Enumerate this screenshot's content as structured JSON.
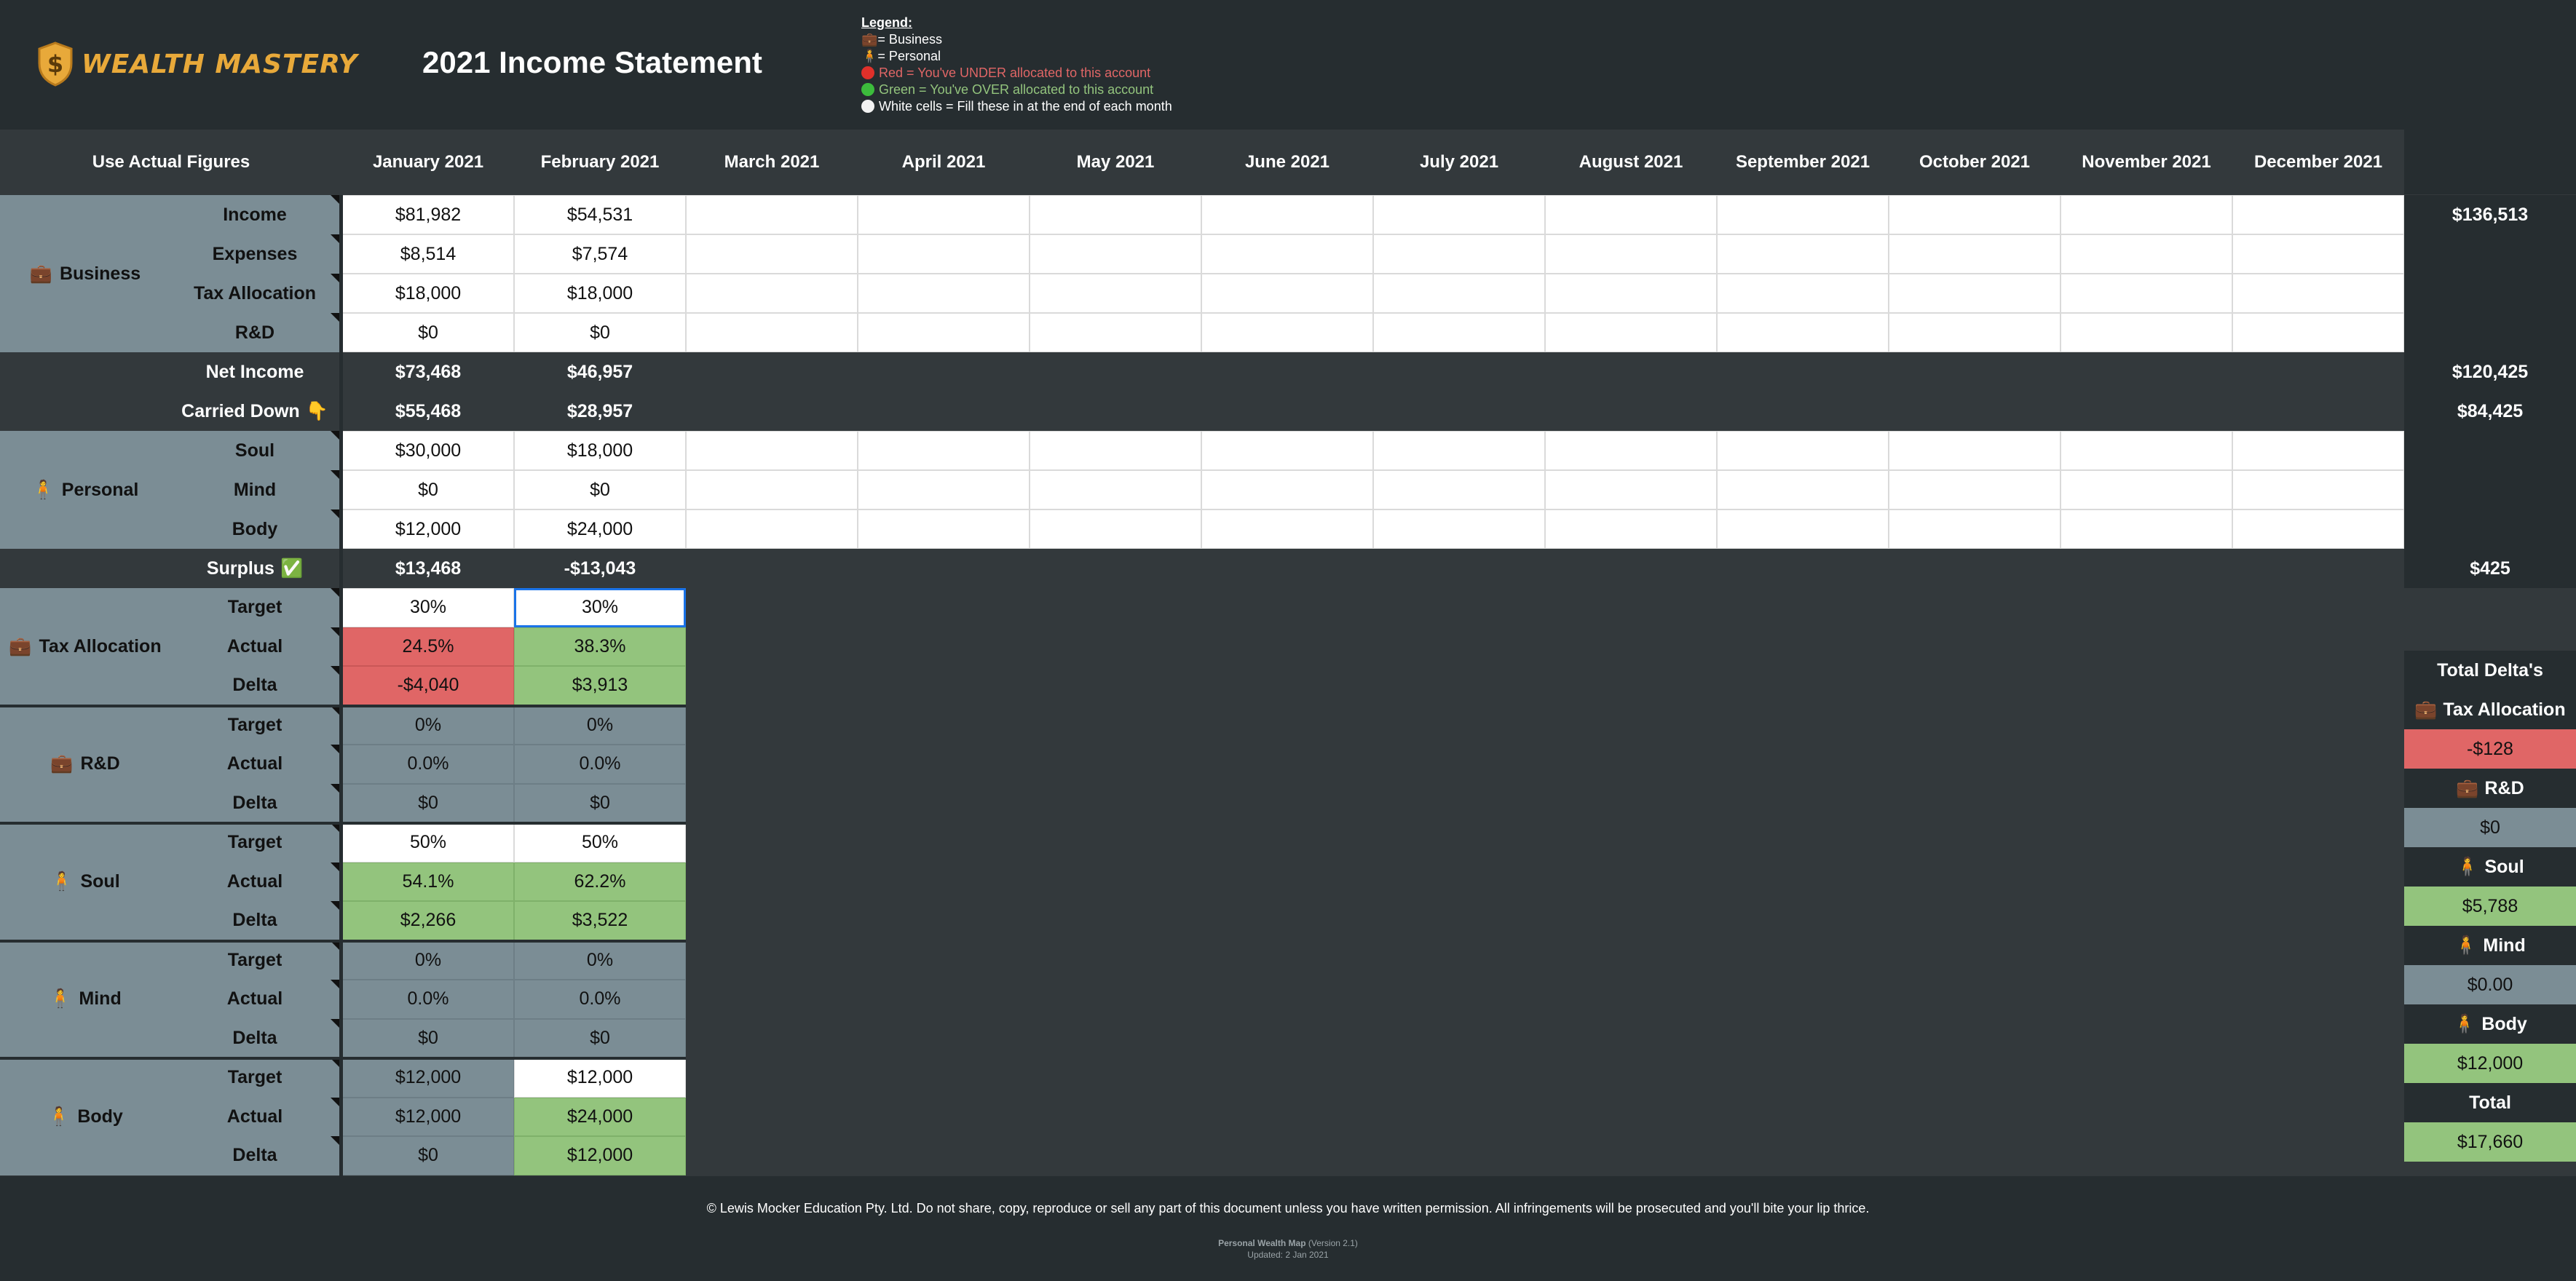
{
  "brand": {
    "name": "WEALTH MASTERY",
    "logo_icon": "shield-dollar-icon",
    "accent": "#e8a93a"
  },
  "title": "2021 Income Statement",
  "legend": {
    "heading": "Legend:",
    "business": "= Business",
    "personal": "= Personal",
    "red": "Red = You've UNDER allocated to this account",
    "green": "Green = You've OVER allocated to this account",
    "white": "White cells = Fill these in at the end of each month",
    "colors": {
      "red": "#e06666",
      "green": "#93c47d",
      "red_text": "#e06666",
      "green_text": "#93c47d"
    }
  },
  "header": {
    "corner": "Use Actual Figures",
    "months": [
      "January 2021",
      "February 2021",
      "March 2021",
      "April 2021",
      "May 2021",
      "June 2021",
      "July 2021",
      "August 2021",
      "September 2021",
      "October 2021",
      "November 2021",
      "December 2021"
    ]
  },
  "business": {
    "group": "Business",
    "rows": [
      {
        "label": "Income",
        "values": [
          "$81,982",
          "$54,531"
        ],
        "total": "$136,513"
      },
      {
        "label": "Expenses",
        "values": [
          "$8,514",
          "$7,574"
        ],
        "total": ""
      },
      {
        "label": "Tax Allocation",
        "values": [
          "$18,000",
          "$18,000"
        ],
        "total": ""
      },
      {
        "label": "R&D",
        "values": [
          "$0",
          "$0"
        ],
        "total": ""
      }
    ]
  },
  "net_income": {
    "label": "Net Income",
    "values": [
      "$73,468",
      "$46,957"
    ],
    "total": "$120,425"
  },
  "carried_down": {
    "label": "Carried Down",
    "icon": "👇",
    "values": [
      "$55,468",
      "$28,957"
    ],
    "total": "$84,425"
  },
  "personal": {
    "group": "Personal",
    "rows": [
      {
        "label": "Soul",
        "values": [
          "$30,000",
          "$18,000"
        ]
      },
      {
        "label": "Mind",
        "values": [
          "$0",
          "$0"
        ]
      },
      {
        "label": "Body",
        "values": [
          "$12,000",
          "$24,000"
        ]
      }
    ]
  },
  "surplus": {
    "label": "Surplus",
    "icon": "✅",
    "values": [
      "$13,468",
      "-$13,043"
    ],
    "total": "$425"
  },
  "allocations": [
    {
      "group": "Tax Allocation",
      "kind": "business",
      "target": [
        "30%",
        "30%"
      ],
      "actual": [
        "24.5%",
        "38.3%"
      ],
      "delta": [
        "-$4,040",
        "$3,913"
      ]
    },
    {
      "group": "R&D",
      "kind": "business",
      "target": [
        "0%",
        "0%"
      ],
      "actual": [
        "0.0%",
        "0.0%"
      ],
      "delta": [
        "$0",
        "$0"
      ]
    },
    {
      "group": "Soul",
      "kind": "personal",
      "target": [
        "50%",
        "50%"
      ],
      "actual": [
        "54.1%",
        "62.2%"
      ],
      "delta": [
        "$2,266",
        "$3,522"
      ]
    },
    {
      "group": "Mind",
      "kind": "personal",
      "target": [
        "0%",
        "0%"
      ],
      "actual": [
        "0.0%",
        "0.0%"
      ],
      "delta": [
        "$0",
        "$0"
      ]
    },
    {
      "group": "Body",
      "kind": "personal",
      "target": [
        "$12,000",
        "$12,000"
      ],
      "actual": [
        "$12,000",
        "$24,000"
      ],
      "delta": [
        "$0",
        "$12,000"
      ]
    }
  ],
  "row_labels": {
    "target": "Target",
    "actual": "Actual",
    "delta": "Delta"
  },
  "totals_panel": {
    "heading": "Total Delta's",
    "items": [
      {
        "label": "Tax Allocation",
        "value": "-$128"
      },
      {
        "label": "R&D",
        "value": "$0"
      },
      {
        "label": "Soul",
        "value": "$5,788"
      },
      {
        "label": "Mind",
        "value": "$0.00"
      },
      {
        "label": "Body",
        "value": "$12,000"
      },
      {
        "label": "Total",
        "value": "$17,660"
      }
    ]
  },
  "footer": {
    "copyright": "© Lewis Mocker Education Pty. Ltd. Do not share, copy, reproduce or sell any part of this document unless you have written permission. All infringements will be prosecuted and you'll bite your lip thrice.",
    "product": "Personal Wealth Map",
    "version": "(Version 2.1)",
    "updated": "Updated: 2 Jan 2021"
  }
}
